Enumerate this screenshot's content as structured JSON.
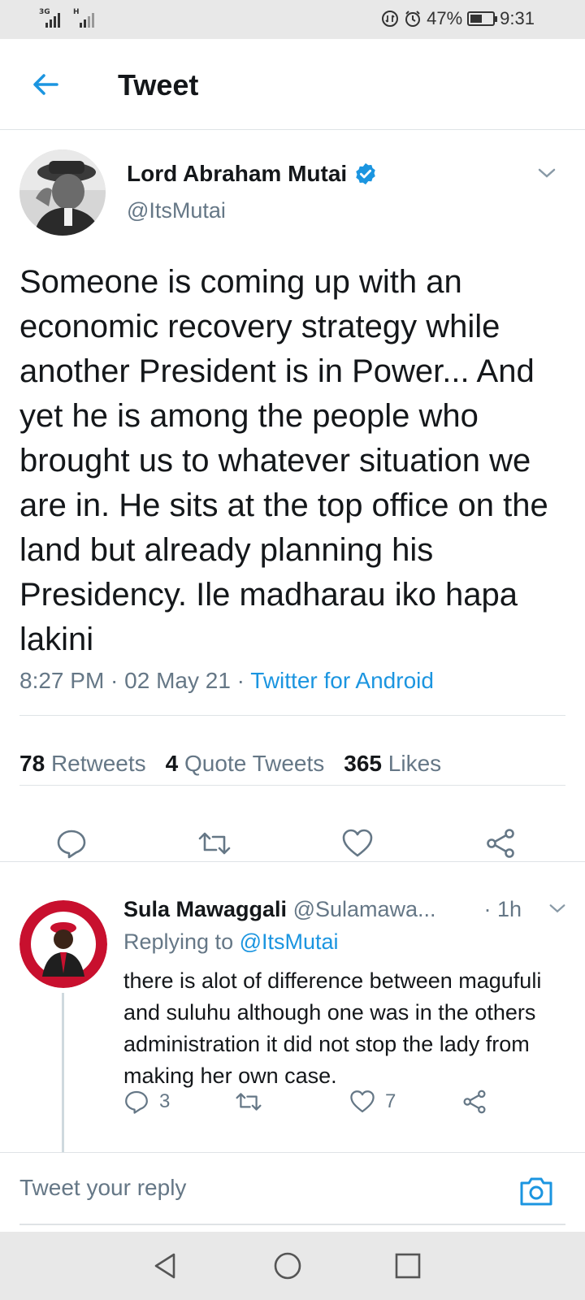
{
  "status_bar": {
    "signal1": "3G",
    "signal2": "H",
    "battery": "47%",
    "time": "9:31",
    "icons": [
      "data-saver-icon",
      "alarm-icon",
      "battery-icon"
    ]
  },
  "header": {
    "title": "Tweet",
    "back_icon": "arrow-left-icon"
  },
  "tweet": {
    "author_name": "Lord Abraham Mutai",
    "author_handle": "@ItsMutai",
    "verified": true,
    "text": "Someone is coming up with an economic recovery strategy while another President is in Power... And yet he is among the people who brought us to whatever situation we are in. He sits at the top office on the land but already planning his Presidency. Ile madharau iko hapa lakini",
    "time": "8:27 PM · 02 May 21 · ",
    "source": "Twitter for Android",
    "stats": {
      "retweets_count": "78",
      "retweets_label": "Retweets",
      "quotes_count": "4",
      "quotes_label": "Quote Tweets",
      "likes_count": "365",
      "likes_label": "Likes"
    }
  },
  "reply": {
    "name": "Sula Mawaggali",
    "handle": "@Sulamawa...",
    "time": "· 1h",
    "replying_prefix": "Replying to ",
    "replying_to": "@ItsMutai",
    "text": "there is alot of difference between magufuli and suluhu although one was in the others administration it did not stop the lady from making her own case.",
    "reply_count": "3",
    "like_count": "7"
  },
  "compose": {
    "placeholder": "Tweet your reply"
  },
  "colors": {
    "accent": "#1b95e0",
    "secondary_text": "#657786",
    "primary_text": "#14171a",
    "divider": "#dfe3e6"
  }
}
